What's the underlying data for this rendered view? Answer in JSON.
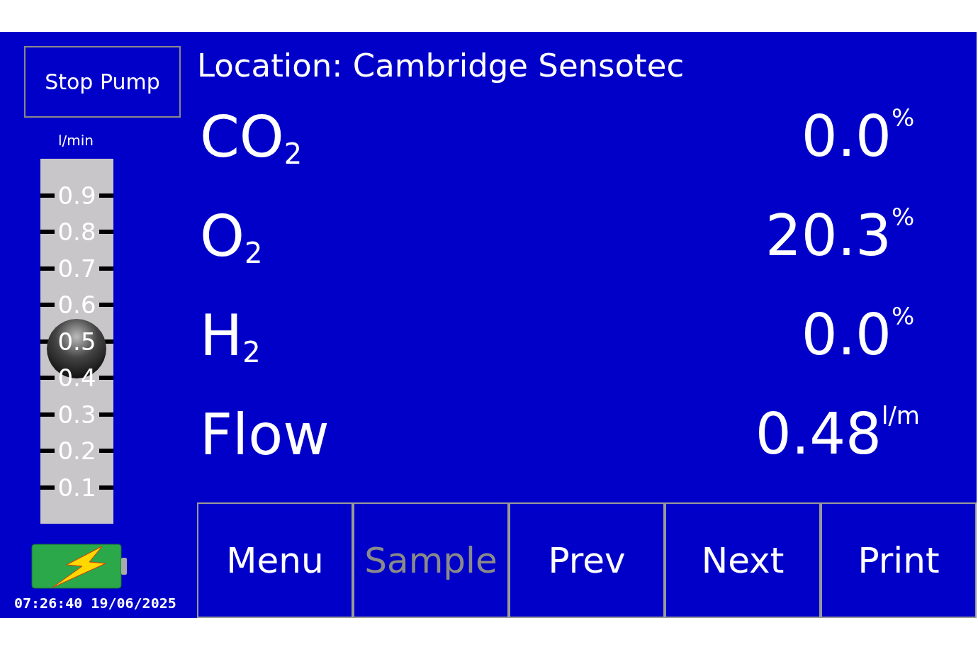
{
  "pump_button": {
    "label": "Stop Pump"
  },
  "flow_slider": {
    "unit": "l/min",
    "ticks": [
      "0.9",
      "0.8",
      "0.7",
      "0.6",
      "0.5",
      "0.4",
      "0.3",
      "0.2",
      "0.1"
    ],
    "level": 0.48
  },
  "datetime": "07:26:40 19/06/2025",
  "location": "Location: Cambridge Sensotec",
  "readings": [
    {
      "label": "CO$_{2}$",
      "value": "0.0",
      "unit": "%"
    },
    {
      "label": "O$_{2}$",
      "value": "20.3",
      "unit": "%"
    },
    {
      "label": "H$_{2}$",
      "value": "0.0",
      "unit": "%"
    },
    {
      "label": "Flow",
      "value": "0.48",
      "unit": "l/m"
    }
  ],
  "buttons": [
    {
      "label": "Menu",
      "disabled": false
    },
    {
      "label": "Sample",
      "disabled": true
    },
    {
      "label": "Prev",
      "disabled": false
    },
    {
      "label": "Next",
      "disabled": false
    },
    {
      "label": "Print",
      "disabled": false
    }
  ]
}
